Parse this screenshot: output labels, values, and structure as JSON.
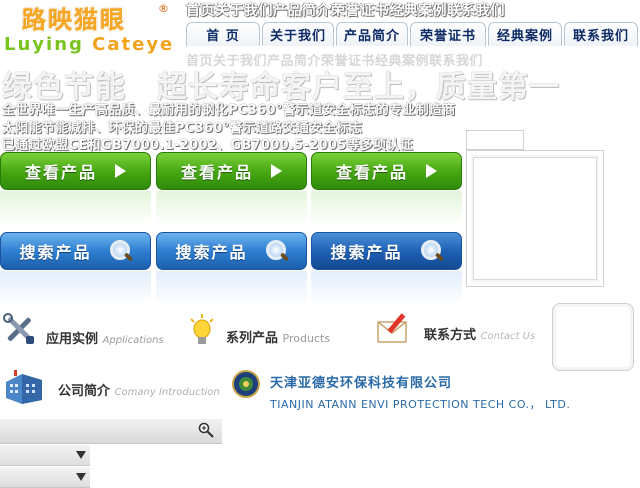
{
  "logo": {
    "cn": "路映猫眼",
    "reg": "®",
    "en_part1": "Luying ",
    "en_part2": "Cateye"
  },
  "top_ghost_text": "首页关于我们产品简介荣誉证书经典案例联系我们",
  "second_ghost_text": "首页关于我们产品简介荣誉证书经典案例联系我们",
  "nav": {
    "tabs": [
      {
        "label": "首 页"
      },
      {
        "label": "关于我们"
      },
      {
        "label": "产品简介"
      },
      {
        "label": "荣誉证书"
      },
      {
        "label": "经典案例"
      },
      {
        "label": "联系我们"
      }
    ]
  },
  "slogan": "绿色节能　超长寿命客户至上，质量第一",
  "descriptions": [
    "全世界唯一生产高品质、最耐用的钢化PC360°警示道安全标志的专业制造商",
    "太阳能节能减排、环保的最佳PC360°警示道路交通安全标志",
    "已通过欧盟CE和GB7000.1-2002、GB7000.5-2005等多项认证"
  ],
  "buttons": {
    "view_label": "查看产品",
    "search_label": "搜索产品"
  },
  "sections": [
    {
      "cn": "应用实例",
      "en": "Applications",
      "icon": "tools-icon"
    },
    {
      "cn": "系列产品",
      "en": "Products",
      "icon": "bulb-icon"
    },
    {
      "cn": "联系方式",
      "en": "Contact Us",
      "icon": "pen-icon"
    },
    {
      "cn": "公司简介",
      "en": "Comany Introduction",
      "icon": "building-icon"
    }
  ],
  "company": {
    "cn": "天津亚德安环保科技有限公司",
    "en": "TIANJIN ATANN ENVI PROTECTION TECH CO.， LTD."
  },
  "colors": {
    "green": "#49a814",
    "blue": "#2f7fd0",
    "nav_text": "#0f2b66",
    "company_text": "#2a6aa8"
  }
}
